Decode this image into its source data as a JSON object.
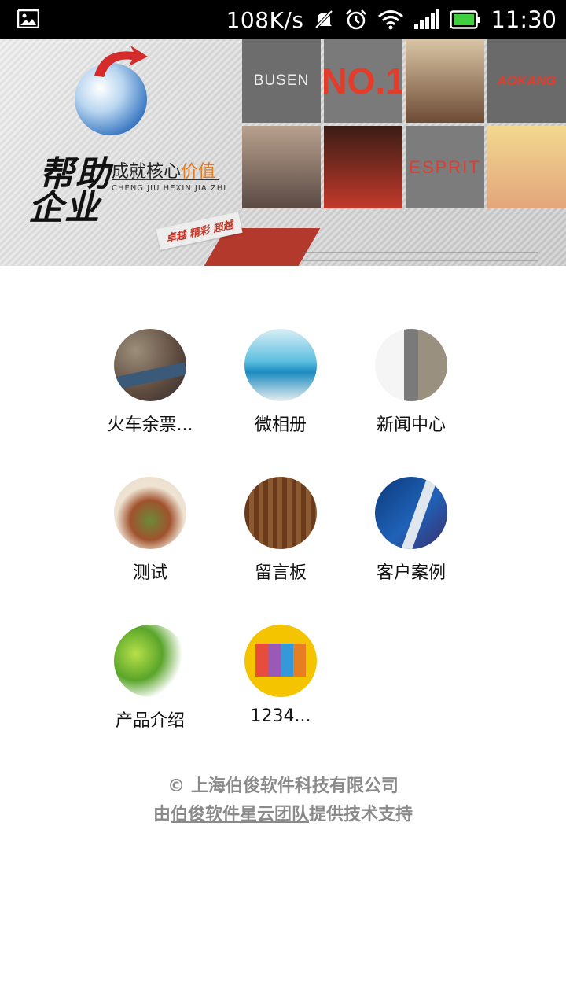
{
  "status_bar": {
    "left_icon": "image-notification-icon",
    "speed": "108K/s",
    "icons": [
      "mute-icon",
      "alarm-icon",
      "wifi-icon",
      "signal-icon",
      "battery-icon"
    ],
    "time": "11:30"
  },
  "banner": {
    "slogan_line1": "帮助",
    "slogan_line2": "企业",
    "subtitle_main": "成就核心",
    "subtitle_accent": "价值",
    "pinyin": "CHENG JIU HEXIN JIA ZHI",
    "tagline": "卓越 精彩 超越",
    "brand_tiles": [
      "BUSEN",
      "NO.1",
      "",
      "AOKANG",
      "",
      "",
      "ESPRIT",
      ""
    ],
    "slide_count": 3,
    "active_slide": 2
  },
  "grid": {
    "items": [
      {
        "label": "火车余票...",
        "icon": "train-tickets-icon"
      },
      {
        "label": "微相册",
        "icon": "photo-album-icon"
      },
      {
        "label": "新闻中心",
        "icon": "news-center-icon"
      },
      {
        "label": "测试",
        "icon": "test-icon"
      },
      {
        "label": "留言板",
        "icon": "message-board-icon"
      },
      {
        "label": "客户案例",
        "icon": "customer-cases-icon"
      },
      {
        "label": "产品介绍",
        "icon": "product-intro-icon"
      },
      {
        "label": "1234...",
        "icon": "item-1234-icon"
      }
    ]
  },
  "footer": {
    "copyright": "© 上海伯俊软件科技有限公司",
    "support_prefix": "由",
    "support_link": "伯俊软件星云团队",
    "support_suffix": "提供技术支持"
  },
  "colors": {
    "status_bar_bg": "#000000",
    "footer_text": "#8a8a8a",
    "accent_orange": "#e87a1e",
    "brand_red": "#e33c2b",
    "battery_green": "#3fcf3f"
  }
}
